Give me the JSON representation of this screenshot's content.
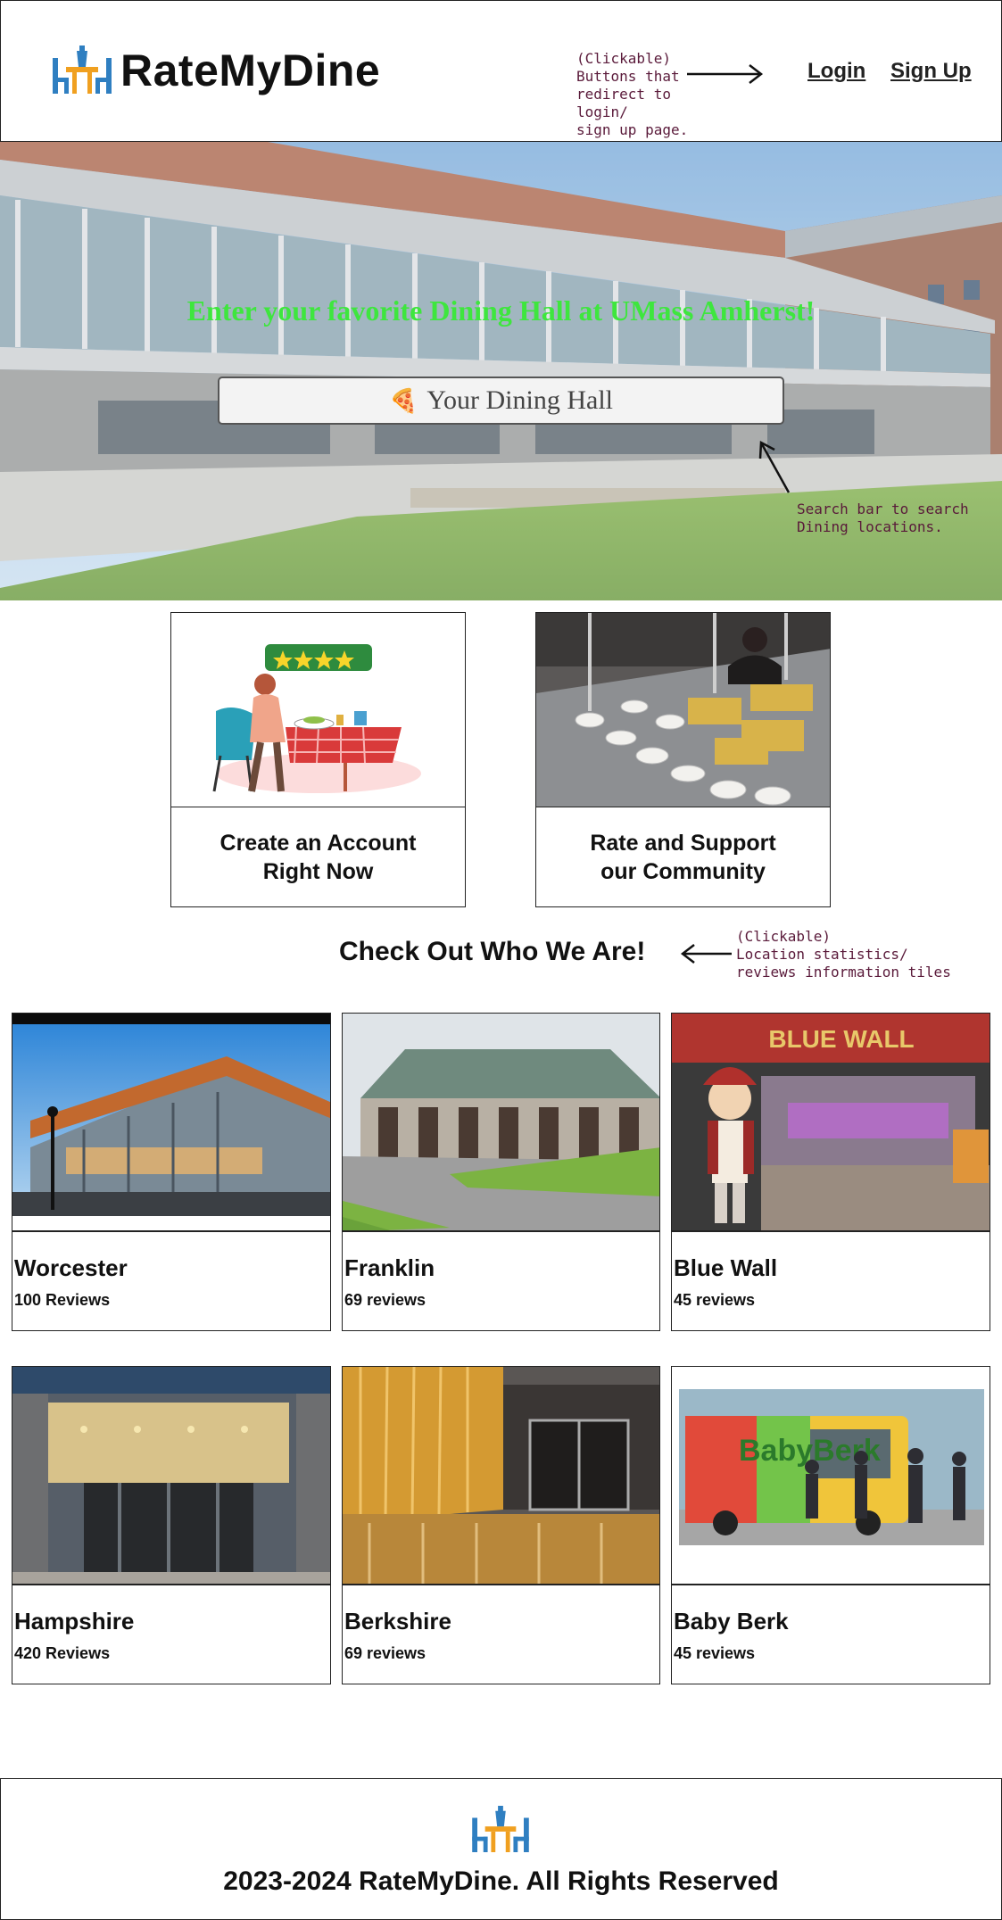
{
  "header": {
    "brand": "RateMyDine",
    "logo_icon": "dining-table-icon",
    "login_label": "Login",
    "signup_label": "Sign Up",
    "annotation": "(Clickable)\nButtons that\nredirect to login/\nsign up page."
  },
  "hero": {
    "title": "Enter your favorite Dining Hall at UMass Amherst!",
    "search_placeholder": "Your Dining Hall",
    "search_icon": "pizza-icon",
    "annotation": "Search bar to search\nDining locations."
  },
  "features": [
    {
      "label": "Create an Account\nRight Now",
      "image": "person-rating-meal-illustration"
    },
    {
      "label": "Rate and Support\nour Community",
      "image": "buffet-line-photo"
    }
  ],
  "section": {
    "title": "Check Out Who We Are!",
    "annotation": "(Clickable)\nLocation statistics/\nreviews information tiles"
  },
  "locations": [
    {
      "name": "Worcester",
      "reviews": "100 Reviews"
    },
    {
      "name": "Franklin",
      "reviews": "69 reviews"
    },
    {
      "name": "Blue Wall",
      "reviews": "45 reviews",
      "sign": "BLUE WALL"
    },
    {
      "name": "Hampshire",
      "reviews": "420 Reviews"
    },
    {
      "name": "Berkshire",
      "reviews": "69 reviews"
    },
    {
      "name": "Baby Berk",
      "reviews": "45 reviews",
      "truck_text": "BabyBerk"
    }
  ],
  "footer": {
    "text": "2023-2024 RateMyDine. All Rights Reserved",
    "logo_icon": "dining-table-icon"
  },
  "colors": {
    "hero_title": "#3ee63e",
    "annotation": "#5a1a3a",
    "logo_blue": "#2f7fc1",
    "logo_orange": "#f0a020"
  }
}
